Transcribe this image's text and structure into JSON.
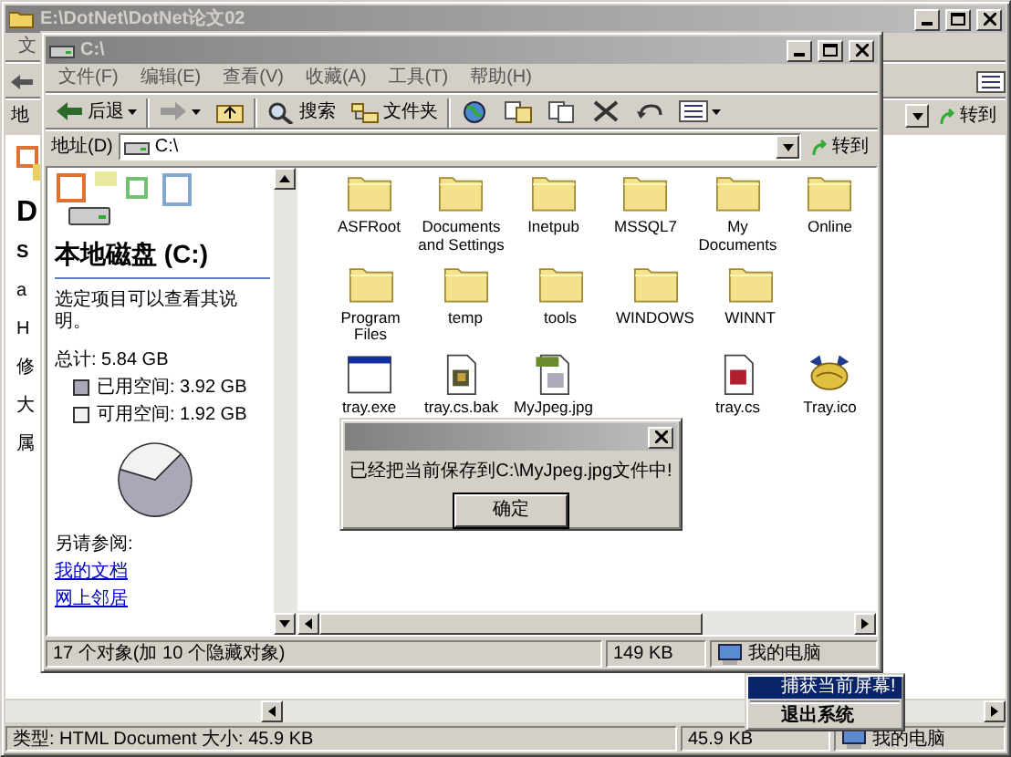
{
  "back_window": {
    "title": "E:\\DotNet\\DotNet论文02",
    "menu_fragment": "文",
    "address_fragment": "地",
    "go": "转到",
    "heading_fragment": "D",
    "text_fragments": [
      "S",
      "a",
      "H",
      "修",
      "大",
      "属"
    ],
    "status_bar": {
      "type_text": "类型: HTML Document 大小: 45.9 KB",
      "size": "45.9 KB",
      "zone": "我的电脑"
    }
  },
  "window": {
    "title": "C:\\",
    "menu": [
      "文件(F)",
      "编辑(E)",
      "查看(V)",
      "收藏(A)",
      "工具(T)",
      "帮助(H)"
    ],
    "toolbar": [
      {
        "kind": "back",
        "label": "后退",
        "dropdown": true
      },
      {
        "kind": "forward",
        "dropdown": true
      },
      {
        "kind": "up",
        "dropdown": false
      },
      {
        "kind": "search",
        "label": "搜索",
        "dropdown": false
      },
      {
        "kind": "folders",
        "label": "文件夹",
        "dropdown": false
      },
      {
        "kind": "history",
        "dropdown": false
      },
      {
        "kind": "move",
        "dropdown": false
      },
      {
        "kind": "copy",
        "dropdown": false
      },
      {
        "kind": "delete",
        "dropdown": false
      },
      {
        "kind": "undo",
        "dropdown": false
      },
      {
        "kind": "views",
        "dropdown": true
      }
    ],
    "address": {
      "label": "地址(D)",
      "value": "C:\\",
      "go": "转到"
    },
    "side_panel": {
      "title": "本地磁盘 (C:)",
      "hint": "选定项目可以查看其说明。",
      "total": "总计: 5.84 GB",
      "legend": [
        {
          "label": "已用空间: 3.92 GB",
          "color": "#a8a8b8"
        },
        {
          "label": "可用空间: 1.92 GB",
          "color": "#f2f2f2"
        }
      ],
      "chart_data": {
        "type": "pie",
        "values": [
          67.1,
          32.9
        ]
      },
      "see_also": "另请参阅:",
      "links": [
        "我的文档",
        "网上邻居"
      ]
    },
    "file_rows": [
      [
        {
          "name": "ASFRoot",
          "kind": "folder"
        },
        {
          "name": "Documents and Settings",
          "kind": "folder"
        },
        {
          "name": "Inetpub",
          "kind": "folder"
        },
        {
          "name": "MSSQL7",
          "kind": "folder"
        },
        {
          "name": "My Documents",
          "kind": "folder"
        },
        {
          "name": "Online",
          "kind": "folder"
        }
      ],
      [
        {
          "name": "Program Files",
          "kind": "folder"
        },
        {
          "name": "temp",
          "kind": "folder"
        },
        {
          "name": "tools",
          "kind": "folder"
        },
        {
          "name": "WINDOWS",
          "kind": "folder"
        },
        {
          "name": "WINNT",
          "kind": "folder"
        }
      ],
      [
        {
          "name": "tray.exe",
          "kind": "exe"
        },
        {
          "name": "tray.cs.bak",
          "kind": "bak"
        },
        {
          "name": "MyJpeg.jpg",
          "kind": "jpg"
        },
        null,
        {
          "name": "tray.cs",
          "kind": "cs"
        },
        {
          "name": "Tray.ico",
          "kind": "ico"
        }
      ]
    ],
    "status_bar": {
      "objects": "17 个对象(加 10 个隐藏对象)",
      "size": "149 KB",
      "zone": "我的电脑"
    }
  },
  "dialog": {
    "message": "已经把当前保存到C:\\MyJpeg.jpg文件中!",
    "button": "确定"
  },
  "context_menu": [
    {
      "label": "捕获当前屏幕!",
      "selected": true,
      "default": false
    },
    {
      "label": "退出系统",
      "selected": false,
      "default": true
    }
  ]
}
